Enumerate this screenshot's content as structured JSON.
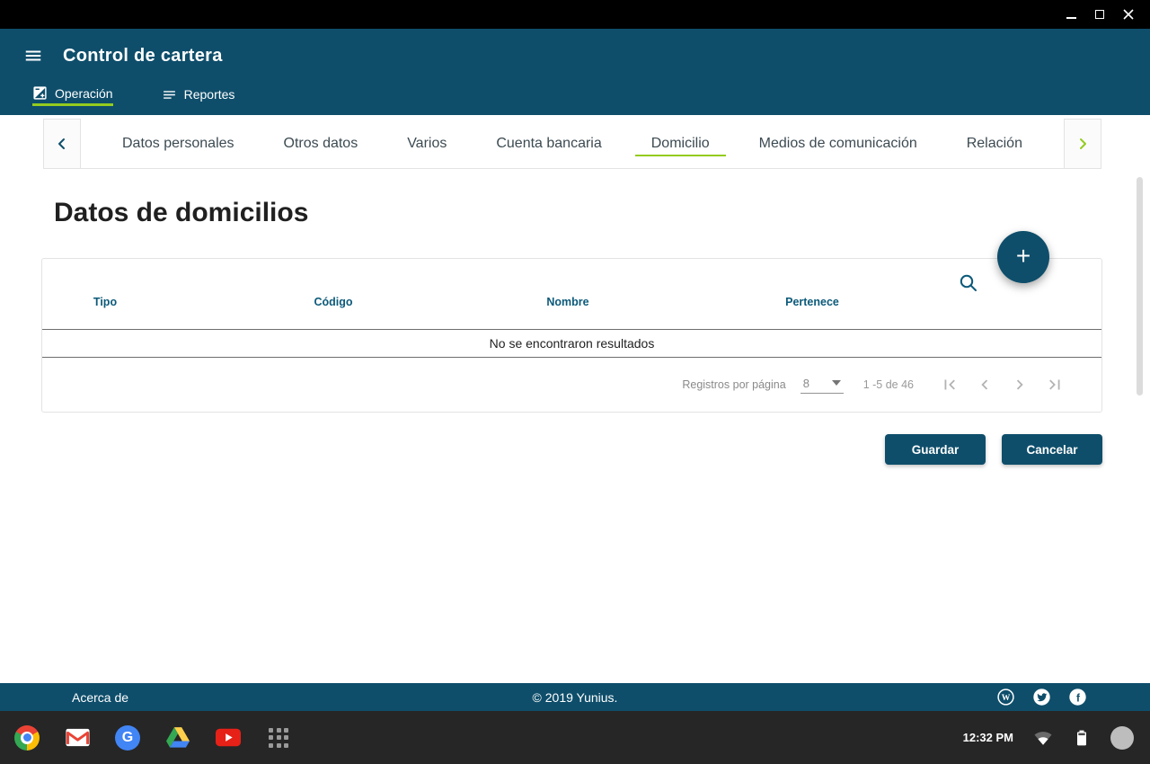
{
  "titlebar": {
    "controls": [
      "minimize",
      "maximize",
      "close"
    ]
  },
  "header": {
    "title": "Control de cartera",
    "menu_icon": "hamburger-menu-icon",
    "nav": {
      "operacion": {
        "label": "Operación",
        "icon": "exposure-icon",
        "active": true
      },
      "reportes": {
        "label": "Reportes",
        "icon": "notes-icon",
        "active": false
      }
    }
  },
  "tabstrip": {
    "prev_icon": "chevron-left-icon",
    "next_icon": "chevron-right-icon",
    "tabs": [
      {
        "label": "Datos personales",
        "active": false
      },
      {
        "label": "Otros datos",
        "active": false
      },
      {
        "label": "Varios",
        "active": false
      },
      {
        "label": "Cuenta bancaria",
        "active": false
      },
      {
        "label": "Domicilio",
        "active": true
      },
      {
        "label": "Medios de comunicación",
        "active": false
      },
      {
        "label": "Relación",
        "active": false
      }
    ]
  },
  "page": {
    "title": "Datos de domicilios"
  },
  "table": {
    "search_icon": "search-icon",
    "columns": [
      "Tipo",
      "Código",
      "Nombre",
      "Pertenece"
    ],
    "empty_message": "No se encontraron resultados",
    "pagination": {
      "per_page_label": "Registros por página",
      "per_page_value": "8",
      "range_text": "1 -5 de 46",
      "controls": [
        "first-page-icon",
        "previous-page-icon",
        "next-page-icon",
        "last-page-icon"
      ]
    }
  },
  "actions": {
    "add_icon": "plus-icon",
    "save": "Guardar",
    "cancel": "Cancelar"
  },
  "footer": {
    "about": "Acerca de",
    "copyright": "© 2019 Yunius.",
    "social": [
      "wordpress-icon",
      "twitter-icon",
      "facebook-icon"
    ]
  },
  "shelf": {
    "apps": [
      "chrome-icon",
      "gmail-icon",
      "google-icon",
      "drive-icon",
      "youtube-icon",
      "apps-grid-icon"
    ],
    "time": "12:32 PM",
    "status": [
      "wifi-icon",
      "battery-icon",
      "avatar"
    ]
  },
  "colors": {
    "teal": "#0e4e6b",
    "teal_text": "#0c5a7a",
    "green_accent": "#94cb1f",
    "shelf_bg": "#262626",
    "titlebar_bg": "#000000"
  }
}
